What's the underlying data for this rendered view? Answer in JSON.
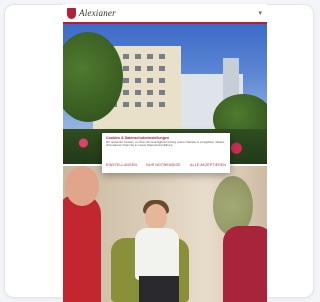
{
  "header": {
    "logo_text": "Alexianer",
    "logo_icon": "shield-icon",
    "menu_icon": "chevron-down-icon",
    "menu_glyph": "▾"
  },
  "cookie_modal": {
    "title": "Cookies & Datenschutzeinstellungen",
    "text": "Wir verwenden Cookies, um Ihnen die bestmögliche Nutzung unserer Website zu ermöglichen. Weitere Informationen finden Sie in unserer Datenschutzerklärung.",
    "buttons": [
      "Einstellungen",
      "Nur notwendige",
      "Alle akzeptieren"
    ]
  },
  "colors": {
    "accent": "#b0203a",
    "page_background": "#f4f5f8"
  }
}
